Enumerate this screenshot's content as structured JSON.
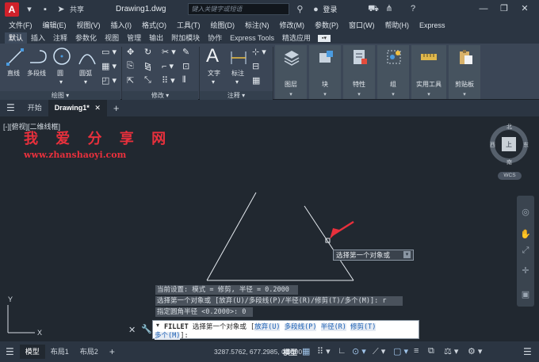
{
  "window": {
    "logo": "A",
    "share_label": "共享",
    "title": "Drawing1.dwg",
    "search_placeholder": "键入关键字或短语",
    "login": "登录"
  },
  "menu": [
    "文件(F)",
    "编辑(E)",
    "视图(V)",
    "插入(I)",
    "格式(O)",
    "工具(T)",
    "绘图(D)",
    "标注(N)",
    "修改(M)",
    "参数(P)",
    "窗口(W)",
    "帮助(H)",
    "Express"
  ],
  "ribbon_tabs": [
    "默认",
    "插入",
    "注释",
    "参数化",
    "视图",
    "管理",
    "输出",
    "附加模块",
    "协作",
    "Express Tools",
    "精选应用"
  ],
  "ribbon": {
    "draw_tools": [
      "直线",
      "多段线",
      "圆",
      "圆弧"
    ],
    "text_tools": [
      "文字",
      "标注"
    ],
    "groups": {
      "draw": "绘图",
      "modify": "修改",
      "annotation": "注释"
    },
    "big_buttons": [
      "图层",
      "块",
      "特性",
      "组",
      "实用工具",
      "剪贴板"
    ]
  },
  "doc_tabs": [
    "开始",
    "Drawing1*"
  ],
  "canvas": {
    "view_label": "[-][俯视][二维线框]",
    "watermark_title": "我 爱 分 享 网",
    "watermark_url": "www.zhanshaoyi.com",
    "viewcube": {
      "north": "北",
      "south": "南",
      "west": "西",
      "east": "东",
      "face": "上",
      "wcs": "WCS"
    }
  },
  "command": {
    "history": [
      "当前设置: 模式 = 修剪, 半径 = 0.2000",
      "选择第一个对象或 [放弃(U)/多段线(P)/半径(R)/修剪(T)/多个(M)]: r",
      "指定圆角半径 <0.2000>: 0"
    ],
    "prompt_cmd": "FILLET",
    "prompt_text": "选择第一个对象或 [",
    "options": [
      "放弃(U)",
      "多段线(P)",
      "半径(R)",
      "修剪(T)",
      "多个(M)"
    ],
    "prompt_end": "]:"
  },
  "tooltip": "选择第一个对象或",
  "status": {
    "tabs": [
      "模型",
      "布局1",
      "布局2"
    ],
    "coords": "3287.5762, 677.2985, 0.0000",
    "model_button": "模型"
  }
}
